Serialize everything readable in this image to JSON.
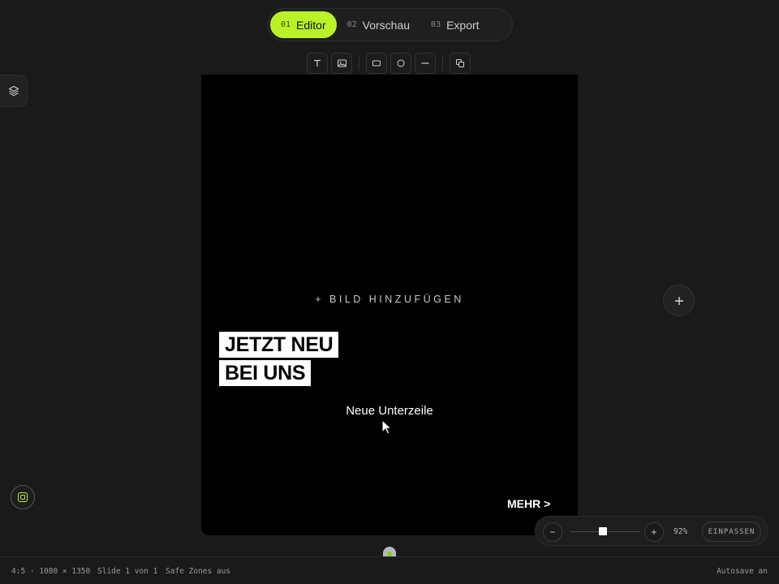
{
  "steps": [
    {
      "num": "01",
      "label": "Editor",
      "active": true
    },
    {
      "num": "02",
      "label": "Vorschau",
      "active": false
    },
    {
      "num": "03",
      "label": "Export",
      "active": false
    }
  ],
  "toolbar": {
    "icons": [
      "text-tool-icon",
      "image-tool-icon",
      "rectangle-tool-icon",
      "circle-tool-icon",
      "line-tool-icon",
      "duplicate-icon"
    ]
  },
  "canvas": {
    "image_placeholder": "+ BILD HINZUFÜGEN",
    "headline_1": "JETZT NEU",
    "headline_2": "BEI UNS",
    "subline": "Neue Unterzeile",
    "cta": "MEHR >"
  },
  "zoom": {
    "minus": "−",
    "plus": "+",
    "percent": "92%",
    "level": 0.92,
    "fit_label": "EINPASSEN"
  },
  "status": {
    "format": "4:5 · 1080 × 1350",
    "slide": "Slide 1 von 1",
    "safe_zones": "Safe Zones aus",
    "autosave": "Autosave an"
  },
  "colors": {
    "accent": "#b9f227",
    "background": "#1a1a1a",
    "canvas": "#000000"
  }
}
